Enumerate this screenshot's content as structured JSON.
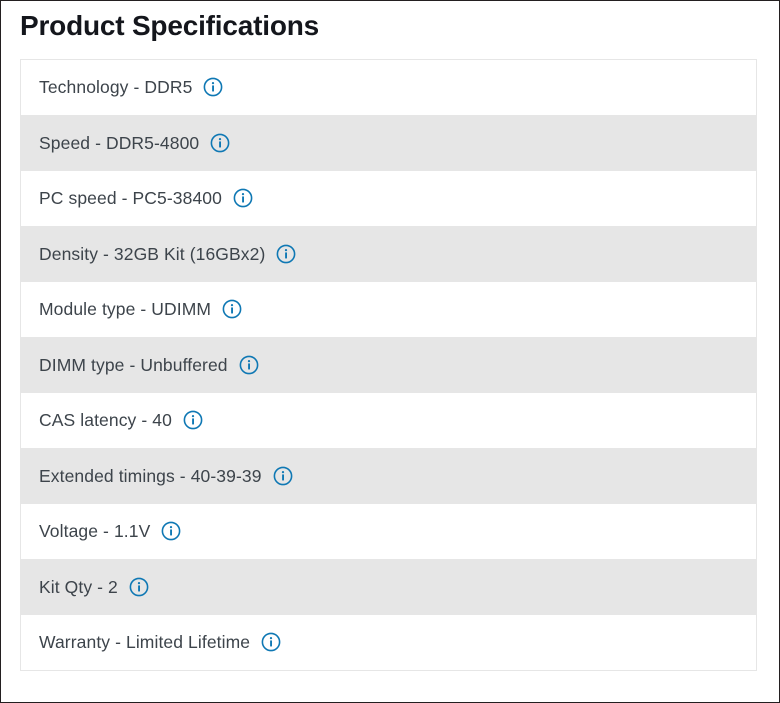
{
  "page": {
    "title": "Product Specifications"
  },
  "icons": {
    "info": "info-circle-icon",
    "info_color": "#0f78b4"
  },
  "colors": {
    "title_text": "#14161c",
    "row_text": "#3d444b",
    "row_stripe": "#e6e6e6",
    "row_plain": "#ffffff",
    "table_border": "#e6e6e6",
    "page_border": "#231f20"
  },
  "spec_table": {
    "rows": [
      {
        "label": "Technology - DDR5",
        "striped": false
      },
      {
        "label": "Speed - DDR5-4800",
        "striped": true
      },
      {
        "label": "PC speed - PC5-38400",
        "striped": false
      },
      {
        "label": "Density - 32GB Kit (16GBx2)",
        "striped": true
      },
      {
        "label": "Module type - UDIMM",
        "striped": false
      },
      {
        "label": "DIMM type - Unbuffered",
        "striped": true
      },
      {
        "label": "CAS latency - 40",
        "striped": false
      },
      {
        "label": "Extended timings - 40-39-39",
        "striped": true
      },
      {
        "label": "Voltage - 1.1V",
        "striped": false
      },
      {
        "label": "Kit Qty - 2",
        "striped": true
      },
      {
        "label": "Warranty - Limited Lifetime",
        "striped": false
      }
    ]
  }
}
